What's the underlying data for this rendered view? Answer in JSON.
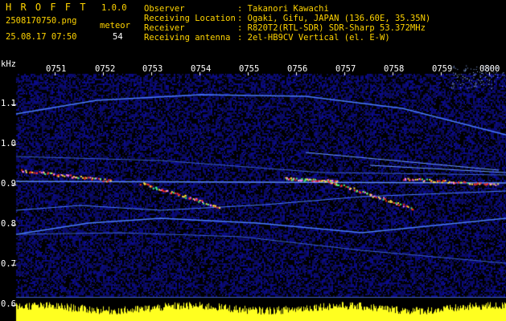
{
  "header": {
    "app_title": "H R O F F T",
    "app_version": "1.0.0",
    "filename": "2508170750.png",
    "datetime": "25.08.17 07:50",
    "meteor_label": "meteor",
    "meteor_count": "54",
    "info": [
      {
        "label": "Observer",
        "value": ": Takanori Kawachi"
      },
      {
        "label": "Receiving Location",
        "value": ": Ogaki, Gifu, JAPAN (136.60E, 35.35N)"
      },
      {
        "label": "Receiver",
        "value": ": R820T2(RTL-SDR) SDR-Sharp 53.372MHz"
      },
      {
        "label": "Receiving antenna",
        "value": ": 2el-HB9CV Vertical (el. E-W)"
      }
    ]
  },
  "axis": {
    "unit_label": "kHz",
    "y_ticks": [
      "1.1",
      "1.0",
      "0.9",
      "0.8",
      "0.7",
      "0.6"
    ],
    "x_ticks": [
      "0751",
      "0752",
      "0753",
      "0754",
      "0755",
      "0756",
      "0757",
      "0758",
      "0759",
      "0800"
    ]
  },
  "colors": {
    "background": "#000000",
    "noise": "#1a1a8c",
    "trace": "#3c6dff",
    "signal_hot": "#ff3020",
    "signal_warm": "#ffe040",
    "signal_green": "#40ff80",
    "histogram": "#ffff20",
    "axis_text": "#ffffff",
    "title_text": "#ffd400"
  }
}
